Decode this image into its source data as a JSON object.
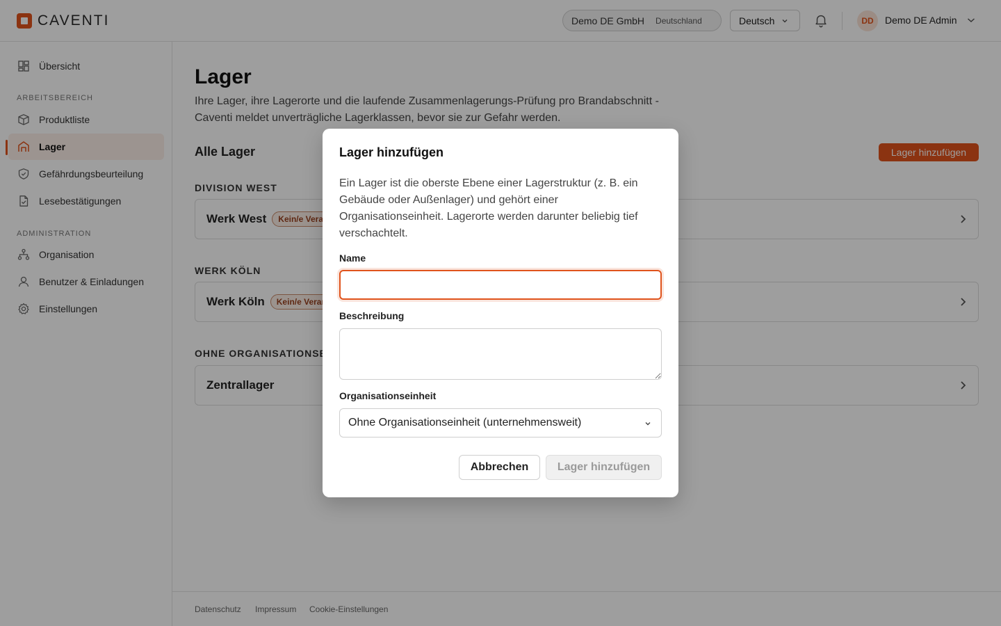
{
  "brand": {
    "name": "CAVENTI",
    "accent": "#e0531c"
  },
  "header": {
    "org_name": "Demo DE GmbH",
    "org_country": "Deutschland",
    "language": "Deutsch",
    "bell_icon": "bell-icon",
    "user_initials": "DD",
    "user_name": "Demo DE Admin"
  },
  "sidebar": {
    "overview": "Übersicht",
    "section_workspace": "ARBEITSBEREICH",
    "items_workspace": [
      {
        "label": "Produktliste",
        "icon": "box-icon"
      },
      {
        "label": "Lager",
        "icon": "warehouse-icon",
        "active": true
      },
      {
        "label": "Gefährdungsbeurteilung",
        "icon": "shield-icon"
      },
      {
        "label": "Lesebestätigungen",
        "icon": "document-check-icon"
      }
    ],
    "section_admin": "ADMINISTRATION",
    "items_admin": [
      {
        "label": "Organisation",
        "icon": "org-tree-icon"
      },
      {
        "label": "Benutzer & Einladungen",
        "icon": "user-icon"
      },
      {
        "label": "Einstellungen",
        "icon": "gear-icon"
      }
    ]
  },
  "main": {
    "title": "Lager",
    "description": "Ihre Lager, ihre Lagerorte und die laufende Zusammenlagerungs-Prüfung pro Brandabschnitt - Caventi meldet unverträgliche Lagerklassen, bevor sie zur Gefahr werden.",
    "section_title": "Alle Lager",
    "add_button": "Lager hinzufügen",
    "groups": [
      {
        "label": "DIVISION WEST",
        "warehouses": [
          {
            "name": "Werk West",
            "badge": "Kein/e Veran"
          }
        ]
      },
      {
        "label": "WERK KÖLN",
        "warehouses": [
          {
            "name": "Werk Köln",
            "badge": "Kein/e Veran"
          }
        ]
      },
      {
        "label": "OHNE ORGANISATIONSEI",
        "warehouses": [
          {
            "name": "Zentrallager",
            "badge": ""
          }
        ]
      }
    ]
  },
  "footer": {
    "privacy": "Datenschutz",
    "imprint": "Impressum",
    "cookies": "Cookie-Einstellungen"
  },
  "modal": {
    "title": "Lager hinzufügen",
    "description": "Ein Lager ist die oberste Ebene einer Lagerstruktur (z. B. ein Gebäude oder Außenlager) und gehört einer Organisationseinheit. Lagerorte werden darunter beliebig tief verschachtelt.",
    "name_label": "Name",
    "name_value": "",
    "description_label": "Beschreibung",
    "description_value": "",
    "org_unit_label": "Organisationseinheit",
    "org_unit_value": "Ohne Organisationseinheit (unternehmensweit)",
    "cancel_button": "Abbrechen",
    "submit_button": "Lager hinzufügen"
  }
}
